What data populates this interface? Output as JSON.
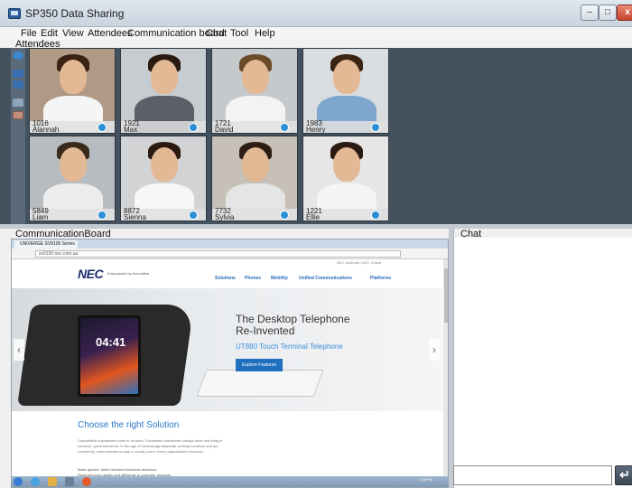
{
  "window": {
    "title": "SP350 Data Sharing",
    "min": "–",
    "max": "□",
    "close": "x"
  },
  "menu": [
    "File",
    "Edit",
    "View",
    "Attendees",
    "Communication board",
    "Chat",
    "Tool",
    "Help"
  ],
  "attendees": {
    "label": "Attendees",
    "tiles": [
      {
        "id": "1016",
        "name": "Alannah",
        "hair": "#3b2214",
        "body": "#f5f5f5",
        "bg": "#b09a86"
      },
      {
        "id": "1921",
        "name": "Max",
        "hair": "#2a1a10",
        "body": "#5a5f68",
        "bg": "#c7ccd1"
      },
      {
        "id": "1721",
        "name": "David",
        "hair": "#6b4a2a",
        "body": "#f3f3f3",
        "bg": "#c5c9cc"
      },
      {
        "id": "1983",
        "name": "Henry",
        "hair": "#3b2414",
        "body": "#7fa6cf",
        "bg": "#d9dde0"
      },
      {
        "id": "5849",
        "name": "Liam",
        "hair": "#3a2a1b",
        "body": "#ececec",
        "bg": "#b7bcc0"
      },
      {
        "id": "8872",
        "name": "Sienna",
        "hair": "#2b1a10",
        "body": "#f7f7f7",
        "bg": "#d1d3d5"
      },
      {
        "id": "7732",
        "name": "Sylvia",
        "hair": "#2e1d12",
        "body": "#e5e5e5",
        "bg": "#c6c0b8"
      },
      {
        "id": "1221",
        "name": "Ellie",
        "hair": "#2b1a12",
        "body": "#f5f5f5",
        "bg": "#e6e6e6"
      }
    ]
  },
  "board": {
    "label": "CommunicationBoard",
    "tab": "UNIVERGE SV9100 Series",
    "address": "sv9100.nec.com.au",
    "brand": "NEC",
    "tagline": "Empowered by Innovation",
    "top_links": "NEC Australia | NEC Global",
    "nav": [
      "Solutions",
      "Phones",
      "Mobility",
      "Unified Communications",
      "Platforms"
    ],
    "hero_title_1": "The Desktop Telephone",
    "hero_title_2": "Re-Invented",
    "hero_sub": "UT880 Touch Terminal Telephone",
    "hero_btn": "Explore Features",
    "screen_time": "04:41",
    "arrow_left": "‹",
    "arrow_right": "›",
    "solutions_title": "Choose the right Solution",
    "solutions_text": "Competitive businesses come in all sizes. Successful businesses always have one thing in common; great teamwork. In the age of increasingly disparate working locations and job complexity, communications play a crucial part in every organisation's success.",
    "bullets": [
      "Make quicker, better informed business decisions",
      "Respond more rapidly and efficiently to customer requests"
    ],
    "clock": "2:39 PM"
  },
  "chat": {
    "label": "Chat",
    "send": "↵"
  }
}
